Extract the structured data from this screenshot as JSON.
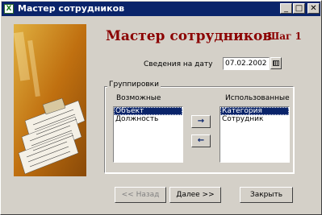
{
  "window": {
    "title": "Мастер сотрудников",
    "app_icon": "excel-icon"
  },
  "titlebar_buttons": {
    "minimize": "_",
    "maximize": "□",
    "close": "✕"
  },
  "header": {
    "title": "Мастер сотрудников",
    "step": "Шаг 1"
  },
  "date": {
    "label": "Сведения на дату",
    "value": "07.02.2002",
    "calendar_icon": "calendar-icon"
  },
  "groupings": {
    "title": "Группировки",
    "available_label": "Возможные",
    "used_label": "Использованные",
    "available_items": [
      {
        "label": "Объект",
        "selected": true
      },
      {
        "label": "Должность",
        "selected": false
      }
    ],
    "used_items": [
      {
        "label": "Категория",
        "selected": true
      },
      {
        "label": "Сотрудник",
        "selected": false
      }
    ],
    "move_right_icon": "arrow-right-icon",
    "move_left_icon": "arrow-left-icon"
  },
  "buttons": {
    "back": "<< Назад",
    "next": "Далее >>",
    "close": "Закрыть"
  },
  "colors": {
    "titlebar": "#0a246a",
    "heading": "#8b0000",
    "selection": "#0a246a",
    "face": "#d4d0c8"
  }
}
